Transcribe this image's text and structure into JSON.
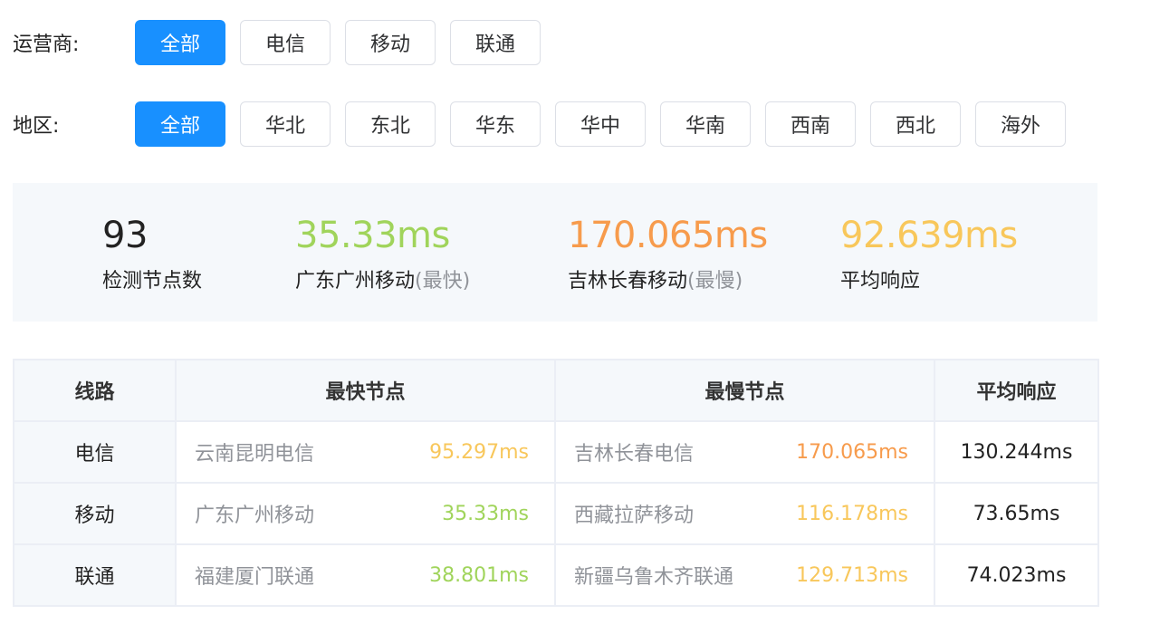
{
  "filters": {
    "operator": {
      "label": "运营商:",
      "options": [
        "全部",
        "电信",
        "移动",
        "联通"
      ],
      "selected": "全部"
    },
    "region": {
      "label": "地区:",
      "options": [
        "全部",
        "华北",
        "东北",
        "华东",
        "华中",
        "华南",
        "西南",
        "西北",
        "海外"
      ],
      "selected": "全部"
    }
  },
  "summary": {
    "nodes": {
      "value": "93",
      "label": "检测节点数"
    },
    "fastest": {
      "value": "35.33ms",
      "label": "广东广州移动",
      "note": "(最快)"
    },
    "slowest": {
      "value": "170.065ms",
      "label": "吉林长春移动",
      "note": "(最慢)"
    },
    "average": {
      "value": "92.639ms",
      "label": "平均响应"
    }
  },
  "colors": {
    "accent": "#1890ff",
    "fast": "#a0d45b",
    "medium": "#f8c75b",
    "slow": "#f79b4c"
  },
  "table": {
    "headers": [
      "线路",
      "最快节点",
      "最慢节点",
      "平均响应"
    ],
    "rows": [
      {
        "line": "电信",
        "fast_node": "云南昆明电信",
        "fast_ms": "95.297ms",
        "slow_node": "吉林长春电信",
        "slow_ms": "170.065ms",
        "avg": "130.244ms"
      },
      {
        "line": "移动",
        "fast_node": "广东广州移动",
        "fast_ms": "35.33ms",
        "slow_node": "西藏拉萨移动",
        "slow_ms": "116.178ms",
        "avg": "73.65ms"
      },
      {
        "line": "联通",
        "fast_node": "福建厦门联通",
        "fast_ms": "38.801ms",
        "slow_node": "新疆乌鲁木齐联通",
        "slow_ms": "129.713ms",
        "avg": "74.023ms"
      }
    ]
  }
}
